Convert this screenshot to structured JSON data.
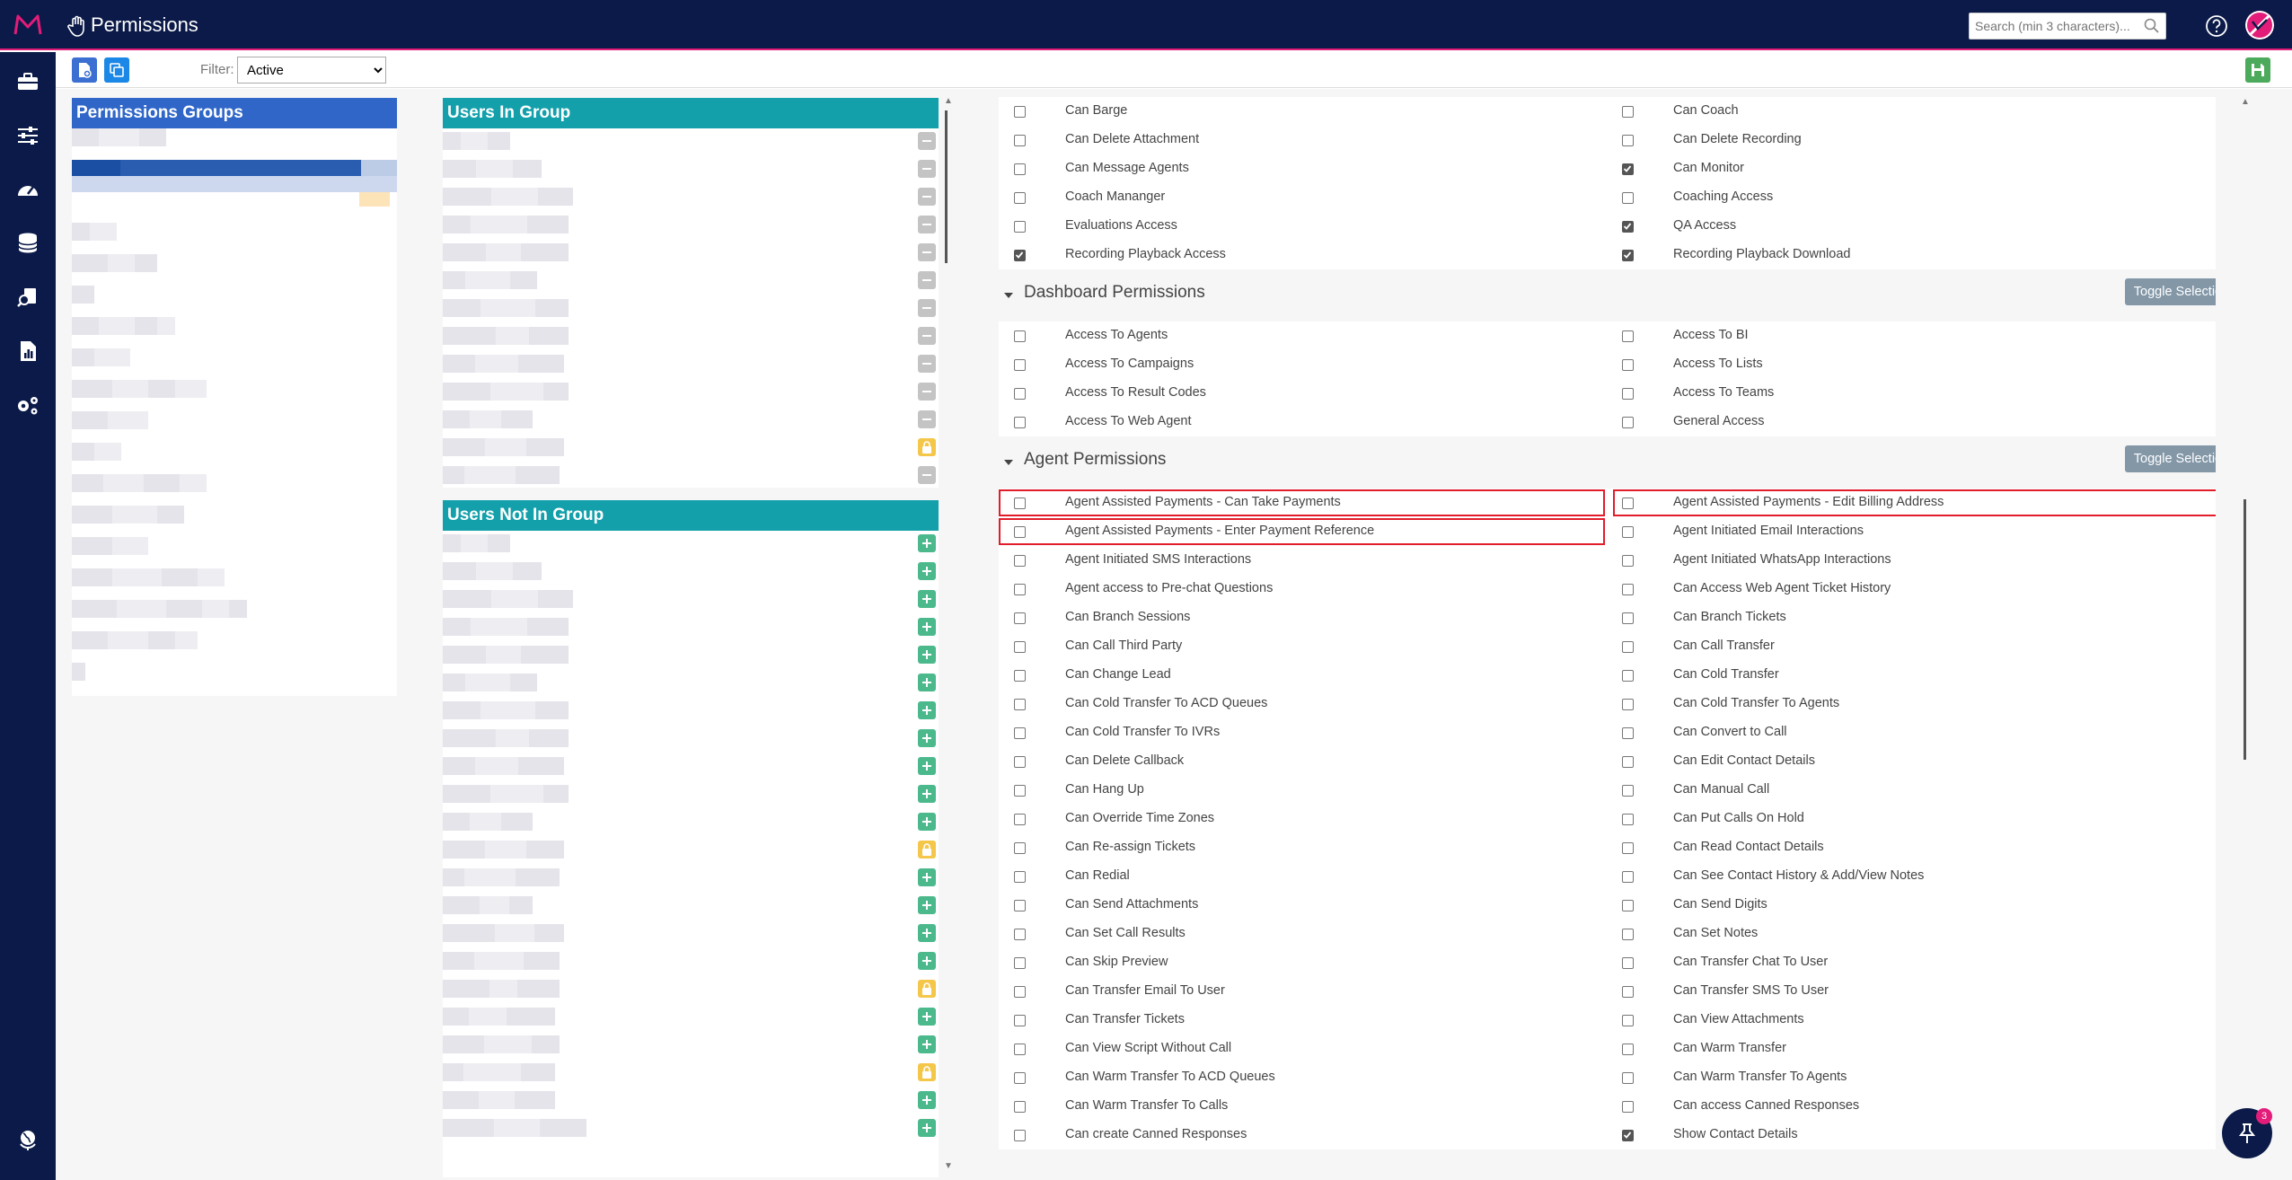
{
  "app": {
    "title": "Permissions"
  },
  "colors": {
    "navy": "#0b1a48",
    "accent": "#e31c79",
    "group_head": "#2f66c8",
    "teal": "#14a0ab",
    "plus": "#4cb98d",
    "lock": "#f4c64a",
    "toggle": "#8397a7",
    "highlight": "#e11d2b"
  },
  "header": {
    "search_placeholder": "Search (min 3 characters)..."
  },
  "toolbar": {
    "filter_label": "Filter:",
    "filter_value": "Active"
  },
  "panels": {
    "groups_title": "Permissions Groups",
    "users_in_title": "Users In Group",
    "users_not_in_title": "Users Not In Group",
    "users_in_actions": [
      "minus",
      "minus",
      "minus",
      "minus",
      "minus",
      "minus",
      "minus",
      "minus",
      "minus",
      "minus",
      "minus",
      "lock",
      "minus"
    ],
    "users_not_in_actions": [
      "plus",
      "plus",
      "plus",
      "plus",
      "plus",
      "plus",
      "plus",
      "plus",
      "plus",
      "plus",
      "plus",
      "lock",
      "plus",
      "plus",
      "plus",
      "plus",
      "lock",
      "plus",
      "plus",
      "lock",
      "plus",
      "plus"
    ]
  },
  "sections": {
    "top": {
      "rows": [
        {
          "left": "Can Barge",
          "left_checked": false,
          "right": "Can Coach",
          "right_checked": false
        },
        {
          "left": "Can Delete Attachment",
          "left_checked": false,
          "right": "Can Delete Recording",
          "right_checked": false
        },
        {
          "left": "Can Message Agents",
          "left_checked": false,
          "right": "Can Monitor",
          "right_checked": true
        },
        {
          "left": "Coach Mananger",
          "left_checked": false,
          "right": "Coaching Access",
          "right_checked": false
        },
        {
          "left": "Evaluations Access",
          "left_checked": false,
          "right": "QA Access",
          "right_checked": true
        },
        {
          "left": "Recording Playback Access",
          "left_checked": true,
          "right": "Recording Playback Download",
          "right_checked": true
        }
      ]
    },
    "dashboard": {
      "title": "Dashboard Permissions",
      "toggle": "Toggle Selection",
      "rows": [
        {
          "left": "Access To Agents",
          "left_checked": false,
          "right": "Access To BI",
          "right_checked": false
        },
        {
          "left": "Access To Campaigns",
          "left_checked": false,
          "right": "Access To Lists",
          "right_checked": false
        },
        {
          "left": "Access To Result Codes",
          "left_checked": false,
          "right": "Access To Teams",
          "right_checked": false
        },
        {
          "left": "Access To Web Agent",
          "left_checked": false,
          "right": "General Access",
          "right_checked": false
        }
      ]
    },
    "agent": {
      "title": "Agent Permissions",
      "toggle": "Toggle Selection",
      "rows": [
        {
          "left": "Agent Assisted Payments - Can Take Payments",
          "left_checked": false,
          "right": "Agent Assisted Payments - Edit Billing Address",
          "right_checked": false,
          "left_hl": true,
          "right_hl": true
        },
        {
          "left": "Agent Assisted Payments - Enter Payment Reference",
          "left_checked": false,
          "right": "Agent Initiated Email Interactions",
          "right_checked": false,
          "left_hl": true
        },
        {
          "left": "Agent Initiated SMS Interactions",
          "left_checked": false,
          "right": "Agent Initiated WhatsApp Interactions",
          "right_checked": false
        },
        {
          "left": "Agent access to Pre-chat Questions",
          "left_checked": false,
          "right": "Can Access Web Agent Ticket History",
          "right_checked": false
        },
        {
          "left": "Can Branch Sessions",
          "left_checked": false,
          "right": "Can Branch Tickets",
          "right_checked": false
        },
        {
          "left": "Can Call Third Party",
          "left_checked": false,
          "right": "Can Call Transfer",
          "right_checked": false
        },
        {
          "left": "Can Change Lead",
          "left_checked": false,
          "right": "Can Cold Transfer",
          "right_checked": false
        },
        {
          "left": "Can Cold Transfer To ACD Queues",
          "left_checked": false,
          "right": "Can Cold Transfer To Agents",
          "right_checked": false
        },
        {
          "left": "Can Cold Transfer To IVRs",
          "left_checked": false,
          "right": "Can Convert to Call",
          "right_checked": false
        },
        {
          "left": "Can Delete Callback",
          "left_checked": false,
          "right": "Can Edit Contact Details",
          "right_checked": false
        },
        {
          "left": "Can Hang Up",
          "left_checked": false,
          "right": "Can Manual Call",
          "right_checked": false
        },
        {
          "left": "Can Override Time Zones",
          "left_checked": false,
          "right": "Can Put Calls On Hold",
          "right_checked": false
        },
        {
          "left": "Can Re-assign Tickets",
          "left_checked": false,
          "right": "Can Read Contact Details",
          "right_checked": false
        },
        {
          "left": "Can Redial",
          "left_checked": false,
          "right": "Can See Contact History & Add/View Notes",
          "right_checked": false
        },
        {
          "left": "Can Send Attachments",
          "left_checked": false,
          "right": "Can Send Digits",
          "right_checked": false
        },
        {
          "left": "Can Set Call Results",
          "left_checked": false,
          "right": "Can Set Notes",
          "right_checked": false
        },
        {
          "left": "Can Skip Preview",
          "left_checked": false,
          "right": "Can Transfer Chat To User",
          "right_checked": false
        },
        {
          "left": "Can Transfer Email To User",
          "left_checked": false,
          "right": "Can Transfer SMS To User",
          "right_checked": false
        },
        {
          "left": "Can Transfer Tickets",
          "left_checked": false,
          "right": "Can View Attachments",
          "right_checked": false
        },
        {
          "left": "Can View Script Without Call",
          "left_checked": false,
          "right": "Can Warm Transfer",
          "right_checked": false
        },
        {
          "left": "Can Warm Transfer To ACD Queues",
          "left_checked": false,
          "right": "Can Warm Transfer To Agents",
          "right_checked": false
        },
        {
          "left": "Can Warm Transfer To Calls",
          "left_checked": false,
          "right": "Can access Canned Responses",
          "right_checked": false
        },
        {
          "left": "Can create Canned Responses",
          "left_checked": false,
          "right": "Show Contact Details",
          "right_checked": true
        }
      ]
    }
  },
  "fab": {
    "badge": "3"
  }
}
